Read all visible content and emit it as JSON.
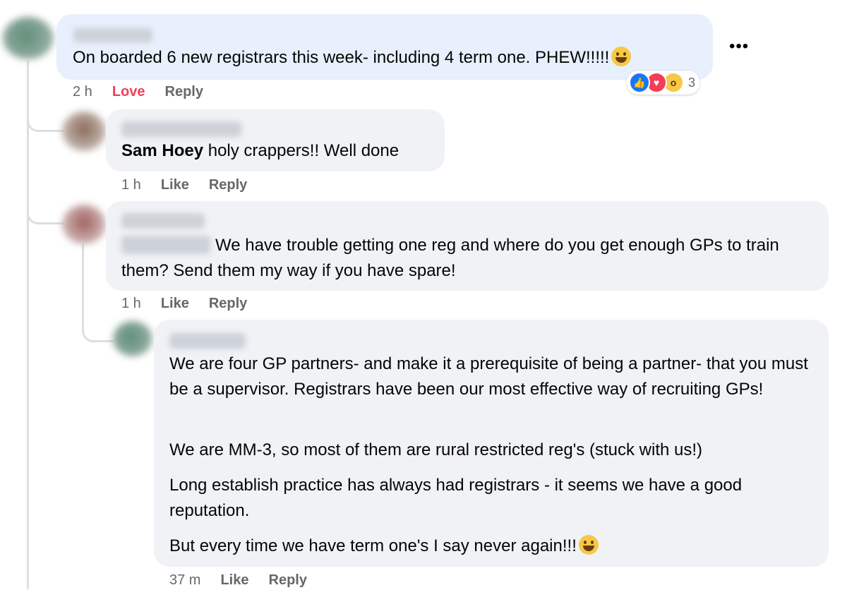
{
  "comments": [
    {
      "text": "On boarded 6 new registrars this week- including 4 term one. PHEW!!!!!",
      "emoji": "grimace-emoji",
      "time": "2 h",
      "love_label": "Love",
      "reply_label": "Reply",
      "reactions": {
        "icons": [
          "like-icon",
          "love-icon",
          "wow-icon"
        ],
        "count": "3"
      }
    },
    {
      "mention": "Sam Hoey",
      "text": " holy crappers!! Well done",
      "time": "1 h",
      "like_label": "Like",
      "reply_label": "Reply"
    },
    {
      "text": "We have trouble getting one reg and where do you get enough GPs to train them? Send them my way if you have spare!",
      "time": "1 h",
      "like_label": "Like",
      "reply_label": "Reply"
    },
    {
      "paragraphs": [
        "We are four GP partners- and make it a prerequisite of being a partner- that you must be a supervisor. Registrars have been our most effective way of recruiting GPs!",
        "We are MM-3, so most of them are rural restricted reg's (stuck with us!)",
        "Long establish practice has always had registrars - it seems we have a good reputation.",
        "But every time we have term one's I say never again!!!"
      ],
      "emoji": "laughing-emoji",
      "time": "37 m",
      "like_label": "Like",
      "reply_label": "Reply"
    }
  ],
  "colors": {
    "bubble": "#f0f2f5",
    "own_bubble": "#e7f0fc",
    "meta": "#65676b",
    "love": "#f33e58",
    "like": "#1877f2"
  }
}
